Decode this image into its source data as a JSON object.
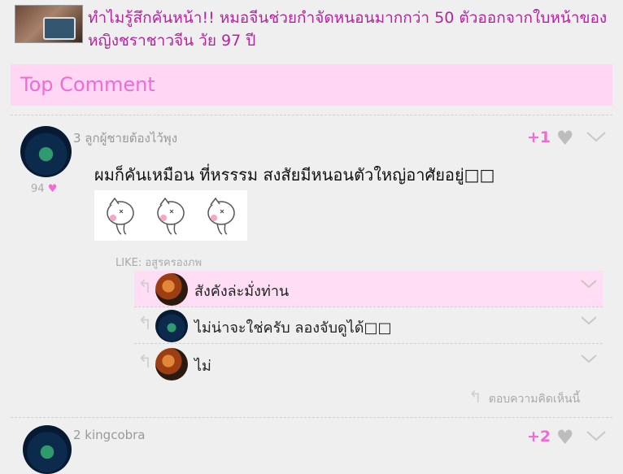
{
  "article": {
    "headline": "ทำไมรู้สึกคันหน้า!! หมอจีนช่วยกำจัดหนอนมากกว่า 50 ตัวออกจากใบหน้าของหญิงชราชาวจีน วัย 97 ปี"
  },
  "section": {
    "title": "Top Comment"
  },
  "comment": {
    "rank_name": "3 ลูกผู้ชายต้องไว้พุง",
    "likes": "94",
    "score": "+1",
    "text": "ผมก็คันเหมือน ที่หรรรม สงสัยมีหนอนตัวใหญ่อาศัยอยู่□□",
    "like_line": "LIKE: อสูรครองภพ",
    "replies": [
      {
        "text": "สังคังล่ะมั่งท่าน",
        "avatar": "ladybug-avatar"
      },
      {
        "text": "ไม่น่าจะใช่ครับ ลองจับดูได้□□",
        "avatar": "planet-avatar"
      },
      {
        "text": "ไม่",
        "avatar": "ladybug-avatar"
      }
    ],
    "reply_button": "ตอบความคิดเห็นนี้"
  },
  "next_comment": {
    "rank_name": "2 kingcobra",
    "score": "+2"
  },
  "icons": {
    "heart": "heart-icon",
    "chevron": "chevron-down-icon",
    "reply": "reply-arrow-icon"
  },
  "colors": {
    "accent": "#f06cd2",
    "headline": "#b0269e",
    "highlight": "#ffd6f3"
  }
}
